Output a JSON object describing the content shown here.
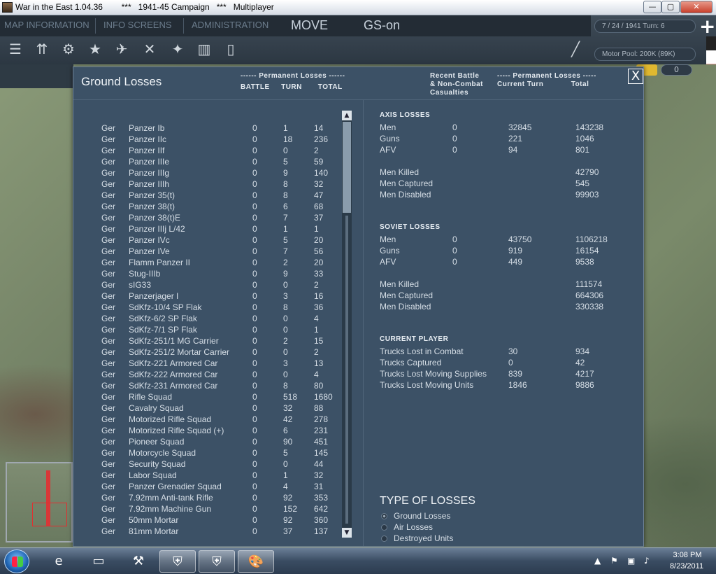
{
  "window": {
    "title": "War in the East 1.04.36        ***   1941-45 Campaign   ***   Multiplayer",
    "minimize": "—",
    "maximize": "▢",
    "close": "✕"
  },
  "menu": {
    "tabs": [
      "MAP INFORMATION",
      "INFO SCREENS",
      "ADMINISTRATION"
    ],
    "mode": "MOVE",
    "gs": "GS-on"
  },
  "status": {
    "date_turn": "7 / 24 / 1941  Turn: 6",
    "motor_pool": "Motor Pool: 200K (89K)",
    "counter": "0"
  },
  "toolbar_icons": [
    "stack-icon",
    "units-icon",
    "gear-icon",
    "star-icon",
    "airfield-icon",
    "air-mission-icon",
    "satellite-icon",
    "rail-icon",
    "supply-icon",
    "pencil-icon"
  ],
  "dialog": {
    "title": "Ground Losses",
    "close": "X",
    "left_header_group": "------ Permanent Losses ------",
    "left_header_cols": "BATTLE     TURN       TOTAL",
    "right_header_recent": "Recent Battle\n& Non-Combat\nCasualties",
    "right_header_group": "----- Permanent Losses -----\nCurrent Turn            Total"
  },
  "losses": [
    {
      "nat": "Ger",
      "unit": "Panzer Ib",
      "battle": "0",
      "turn": "1",
      "total": "14"
    },
    {
      "nat": "Ger",
      "unit": "Panzer IIc",
      "battle": "0",
      "turn": "18",
      "total": "236"
    },
    {
      "nat": "Ger",
      "unit": "Panzer IIf",
      "battle": "0",
      "turn": "0",
      "total": "2"
    },
    {
      "nat": "Ger",
      "unit": "Panzer IIIe",
      "battle": "0",
      "turn": "5",
      "total": "59"
    },
    {
      "nat": "Ger",
      "unit": "Panzer IIIg",
      "battle": "0",
      "turn": "9",
      "total": "140"
    },
    {
      "nat": "Ger",
      "unit": "Panzer IIIh",
      "battle": "0",
      "turn": "8",
      "total": "32"
    },
    {
      "nat": "Ger",
      "unit": "Panzer 35(t)",
      "battle": "0",
      "turn": "8",
      "total": "47"
    },
    {
      "nat": "Ger",
      "unit": "Panzer 38(t)",
      "battle": "0",
      "turn": "6",
      "total": "68"
    },
    {
      "nat": "Ger",
      "unit": "Panzer 38(t)E",
      "battle": "0",
      "turn": "7",
      "total": "37"
    },
    {
      "nat": "Ger",
      "unit": "Panzer IIIj L/42",
      "battle": "0",
      "turn": "1",
      "total": "1"
    },
    {
      "nat": "Ger",
      "unit": "Panzer IVc",
      "battle": "0",
      "turn": "5",
      "total": "20"
    },
    {
      "nat": "Ger",
      "unit": "Panzer IVe",
      "battle": "0",
      "turn": "7",
      "total": "56"
    },
    {
      "nat": "Ger",
      "unit": "Flamm Panzer II",
      "battle": "0",
      "turn": "2",
      "total": "20"
    },
    {
      "nat": "Ger",
      "unit": "Stug-IIIb",
      "battle": "0",
      "turn": "9",
      "total": "33"
    },
    {
      "nat": "Ger",
      "unit": "sIG33",
      "battle": "0",
      "turn": "0",
      "total": "2"
    },
    {
      "nat": "Ger",
      "unit": "Panzerjager I",
      "battle": "0",
      "turn": "3",
      "total": "16"
    },
    {
      "nat": "Ger",
      "unit": "SdKfz-10/4 SP Flak",
      "battle": "0",
      "turn": "8",
      "total": "36"
    },
    {
      "nat": "Ger",
      "unit": "SdKfz-6/2 SP Flak",
      "battle": "0",
      "turn": "0",
      "total": "4"
    },
    {
      "nat": "Ger",
      "unit": "SdKfz-7/1 SP Flak",
      "battle": "0",
      "turn": "0",
      "total": "1"
    },
    {
      "nat": "Ger",
      "unit": "SdKfz-251/1 MG Carrier",
      "battle": "0",
      "turn": "2",
      "total": "15"
    },
    {
      "nat": "Ger",
      "unit": "SdKfz-251/2 Mortar Carrier",
      "battle": "0",
      "turn": "0",
      "total": "2"
    },
    {
      "nat": "Ger",
      "unit": "SdKfz-221 Armored Car",
      "battle": "0",
      "turn": "3",
      "total": "13"
    },
    {
      "nat": "Ger",
      "unit": "SdKfz-222 Armored Car",
      "battle": "0",
      "turn": "0",
      "total": "4"
    },
    {
      "nat": "Ger",
      "unit": "SdKfz-231 Armored Car",
      "battle": "0",
      "turn": "8",
      "total": "80"
    },
    {
      "nat": "Ger",
      "unit": "Rifle Squad",
      "battle": "0",
      "turn": "518",
      "total": "1680"
    },
    {
      "nat": "Ger",
      "unit": "Cavalry Squad",
      "battle": "0",
      "turn": "32",
      "total": "88"
    },
    {
      "nat": "Ger",
      "unit": "Motorized Rifle Squad",
      "battle": "0",
      "turn": "42",
      "total": "278"
    },
    {
      "nat": "Ger",
      "unit": "Motorized Rifle Squad (+)",
      "battle": "0",
      "turn": "6",
      "total": "231"
    },
    {
      "nat": "Ger",
      "unit": "Pioneer Squad",
      "battle": "0",
      "turn": "90",
      "total": "451"
    },
    {
      "nat": "Ger",
      "unit": "Motorcycle Squad",
      "battle": "0",
      "turn": "5",
      "total": "145"
    },
    {
      "nat": "Ger",
      "unit": "Security Squad",
      "battle": "0",
      "turn": "0",
      "total": "44"
    },
    {
      "nat": "Ger",
      "unit": "Labor Squad",
      "battle": "0",
      "turn": "1",
      "total": "32"
    },
    {
      "nat": "Ger",
      "unit": "Panzer Grenadier Squad",
      "battle": "0",
      "turn": "4",
      "total": "31"
    },
    {
      "nat": "Ger",
      "unit": "7.92mm Anti-tank Rifle",
      "battle": "0",
      "turn": "92",
      "total": "353"
    },
    {
      "nat": "Ger",
      "unit": "7.92mm Machine Gun",
      "battle": "0",
      "turn": "152",
      "total": "642"
    },
    {
      "nat": "Ger",
      "unit": "50mm Mortar",
      "battle": "0",
      "turn": "92",
      "total": "360"
    },
    {
      "nat": "Ger",
      "unit": "81mm Mortar",
      "battle": "0",
      "turn": "37",
      "total": "137"
    }
  ],
  "axis": {
    "heading": "AXIS LOSSES",
    "rows": [
      {
        "label": "Men",
        "recent": "0",
        "turn": "32845",
        "total": "143238"
      },
      {
        "label": "Guns",
        "recent": "0",
        "turn": "221",
        "total": "1046"
      },
      {
        "label": "AFV",
        "recent": "0",
        "turn": "94",
        "total": "801"
      }
    ],
    "killed_label": "Men Killed",
    "killed": "42790",
    "captured_label": "Men Captured",
    "captured": "545",
    "disabled_label": "Men Disabled",
    "disabled": "99903"
  },
  "soviet": {
    "heading": "SOVIET LOSSES",
    "rows": [
      {
        "label": "Men",
        "recent": "0",
        "turn": "43750",
        "total": "1106218"
      },
      {
        "label": "Guns",
        "recent": "0",
        "turn": "919",
        "total": "16154"
      },
      {
        "label": "AFV",
        "recent": "0",
        "turn": "449",
        "total": "9538"
      }
    ],
    "killed_label": "Men Killed",
    "killed": "111574",
    "captured_label": "Men Captured",
    "captured": "664306",
    "disabled_label": "Men Disabled",
    "disabled": "330338"
  },
  "player": {
    "heading": "CURRENT PLAYER",
    "rows": [
      {
        "label": "Trucks Lost in Combat",
        "turn": "30",
        "total": "934"
      },
      {
        "label": "Trucks Captured",
        "turn": "0",
        "total": "42"
      },
      {
        "label": "Trucks Lost Moving Supplies",
        "turn": "839",
        "total": "4217"
      },
      {
        "label": "Trucks Lost Moving Units",
        "turn": "1846",
        "total": "9886"
      }
    ]
  },
  "type_of_losses": {
    "title": "TYPE OF LOSSES",
    "options": [
      "Ground Losses",
      "Air Losses",
      "Destroyed Units"
    ],
    "selected": "Ground Losses"
  },
  "taskbar": {
    "time": "3:08 PM",
    "date": "8/23/2011",
    "apps": [
      "ie-icon",
      "folder-icon",
      "hammer-icon",
      "wite-game-icon",
      "wite-game-icon",
      "paint-icon"
    ]
  }
}
